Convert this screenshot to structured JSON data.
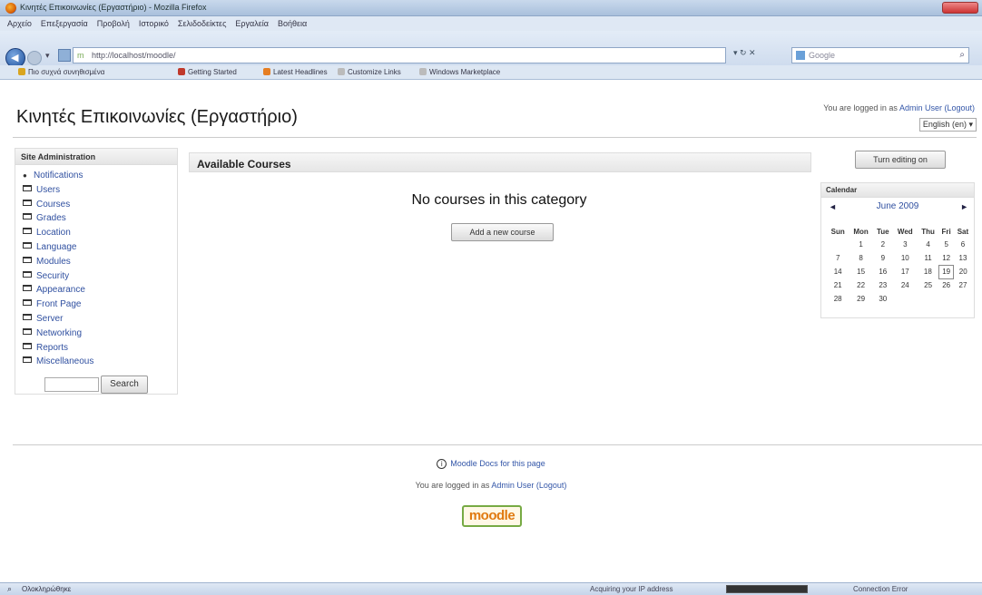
{
  "browser": {
    "window_title": "Κινητές Επικοινωνίες (Εργαστήριο) - Mozilla Firefox",
    "menu": [
      "Αρχείο",
      "Επεξεργασία",
      "Προβολή",
      "Ιστορικό",
      "Σελιδοδείκτες",
      "Εργαλεία",
      "Βοήθεια"
    ],
    "url": "http://localhost/moodle/",
    "search_placeholder": "Google",
    "bookmarks": [
      {
        "label": "Πιο συχνά συνηθισμένα",
        "color": "#d9a520"
      },
      {
        "label": "Getting Started",
        "color": "#c0392b"
      },
      {
        "label": "Latest Headlines",
        "color": "#e67e22"
      },
      {
        "label": "Customize Links",
        "color": "#bbbbbb"
      },
      {
        "label": "Windows Marketplace",
        "color": "#bbbbbb"
      }
    ],
    "status_left": "Ολοκληρώθηκε",
    "status_mid": "Acquiring your IP address",
    "status_conn": "Connection Error"
  },
  "header": {
    "site_title": "Κινητές Επικοινωνίες (Εργαστήριο)",
    "login_prefix": "You are logged in as",
    "user_name": "Admin User",
    "logout": "(Logout)",
    "language": "English (en)"
  },
  "admin_block": {
    "title": "Site Administration",
    "items": [
      {
        "label": "Notifications",
        "type": "bullet"
      },
      {
        "label": "Users",
        "type": "folder"
      },
      {
        "label": "Courses",
        "type": "folder"
      },
      {
        "label": "Grades",
        "type": "folder"
      },
      {
        "label": "Location",
        "type": "folder"
      },
      {
        "label": "Language",
        "type": "folder"
      },
      {
        "label": "Modules",
        "type": "folder"
      },
      {
        "label": "Security",
        "type": "folder"
      },
      {
        "label": "Appearance",
        "type": "folder"
      },
      {
        "label": "Front Page",
        "type": "folder"
      },
      {
        "label": "Server",
        "type": "folder"
      },
      {
        "label": "Networking",
        "type": "folder"
      },
      {
        "label": "Reports",
        "type": "folder"
      },
      {
        "label": "Miscellaneous",
        "type": "folder"
      }
    ],
    "search_value": "",
    "search_button": "Search"
  },
  "main": {
    "section_title": "Available Courses",
    "empty_message": "No courses in this category",
    "add_button": "Add a new course"
  },
  "right": {
    "turn_editing": "Turn editing on",
    "calendar": {
      "title": "Calendar",
      "month": "June 2009",
      "prev": "◄",
      "next": "►",
      "days": [
        "Sun",
        "Mon",
        "Tue",
        "Wed",
        "Thu",
        "Fri",
        "Sat"
      ],
      "weeks": [
        [
          "",
          "1",
          "2",
          "3",
          "4",
          "5",
          "6"
        ],
        [
          "7",
          "8",
          "9",
          "10",
          "11",
          "12",
          "13"
        ],
        [
          "14",
          "15",
          "16",
          "17",
          "18",
          "19",
          "20"
        ],
        [
          "21",
          "22",
          "23",
          "24",
          "25",
          "26",
          "27"
        ],
        [
          "28",
          "29",
          "30",
          "",
          "",
          "",
          ""
        ]
      ],
      "today": "19"
    }
  },
  "footer": {
    "docs_link": "Moodle Docs for this page",
    "login_prefix": "You are logged in as",
    "user_name": "Admin User",
    "logout": "(Logout)",
    "logo_text": "moodle"
  }
}
